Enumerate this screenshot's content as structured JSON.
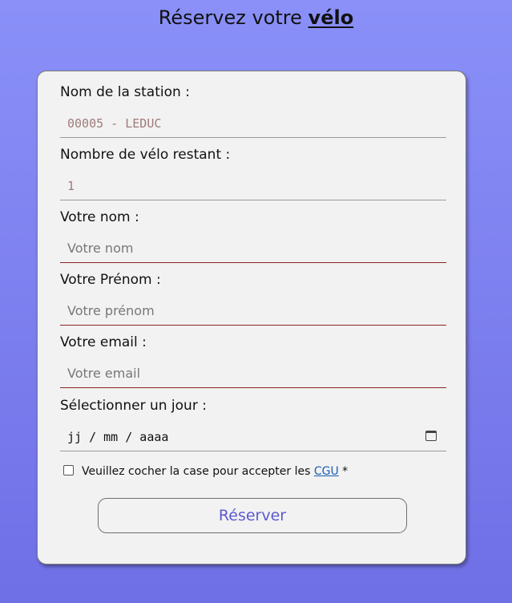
{
  "header": {
    "title_prefix": "Réservez votre",
    "title_accent": "vélo"
  },
  "form": {
    "station": {
      "label": "Nom de la station :",
      "value": "00005 - LEDUC"
    },
    "bikes_left": {
      "label": "Nombre de vélo restant :",
      "value": "1"
    },
    "last_name": {
      "label": "Votre nom :",
      "placeholder": "Votre nom"
    },
    "first_name": {
      "label": "Votre Prénom :",
      "placeholder": "Votre prénom"
    },
    "email": {
      "label": "Votre email :",
      "placeholder": "Votre email"
    },
    "day": {
      "label": "Sélectionner un jour :",
      "value": "jj / mm / aaaa",
      "icon": "calendar-icon"
    },
    "consent": {
      "text": "Veuillez cocher la case pour accepter les",
      "link": "CGU",
      "required_mark": "*",
      "checked": false
    },
    "submit_label": "Réserver"
  }
}
